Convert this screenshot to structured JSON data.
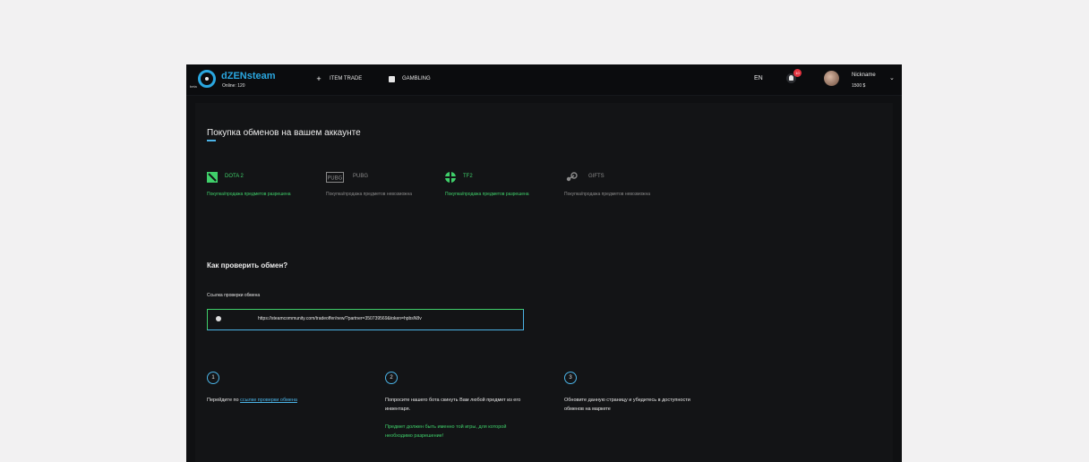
{
  "header": {
    "beta": "beta",
    "brand": "dZENsteam",
    "online": "Online: 120",
    "nav": [
      {
        "label": "ITEM TRADE",
        "icon": "plus-icon"
      },
      {
        "label": "GAMBLING",
        "icon": "dice-icon"
      }
    ],
    "lang": "EN",
    "notifications": "10",
    "nickname": "Nickname",
    "balance": "1500 $"
  },
  "page": {
    "title": "Покупка обменов на вашем аккаунте",
    "games": [
      {
        "name": "DOTA 2",
        "desc": "Покупка/продажа предметов разрешена",
        "enabled": true,
        "icon": "dota2-icon"
      },
      {
        "name": "PUBG",
        "desc": "Покупка/продажа предметов невозможна",
        "enabled": false,
        "icon": "pubg-icon"
      },
      {
        "name": "TF2",
        "desc": "Покупка/продажа предметов разрешена",
        "enabled": true,
        "icon": "tf2-icon"
      },
      {
        "name": "GIFTS",
        "desc": "Покупка/продажа предметов невозможна",
        "enabled": false,
        "icon": "steam-icon"
      }
    ],
    "how_title": "Как проверить обмен?",
    "link_label": "Ссылка проверки обмена",
    "link_value": "https://steamcommunity.com/tradeoffer/new/?partner=350739569&token=hpbsN8v",
    "steps": [
      {
        "num": "1",
        "text_prefix": "Перейдите по ",
        "link": "ссылке проверки обмена"
      },
      {
        "num": "2",
        "text": "Попросите нашего бота скинуть Вам любой предмет из его инвентаря.",
        "note": "Предмет должен быть именно той игры, для которой необходимо разрешение!"
      },
      {
        "num": "3",
        "text": "Обновите данную страницу и убедитесь в доступности обменов на маркете"
      }
    ]
  },
  "colors": {
    "accent": "#2aa7e0",
    "success": "#3fcf6a",
    "danger": "#e2333f",
    "background": "#0f1012"
  }
}
